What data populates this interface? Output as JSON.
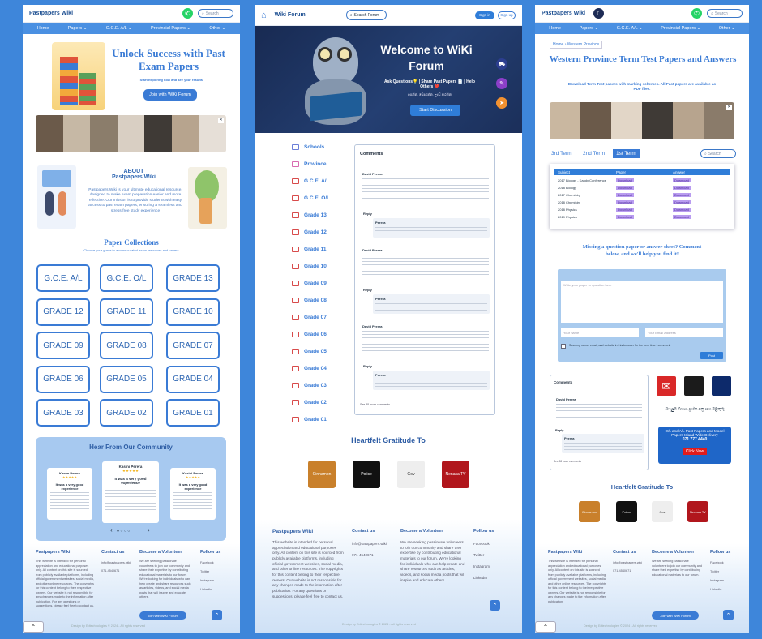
{
  "colors": {
    "accent": "#3a7bd5",
    "nav": "#4a90e2",
    "background": "#3e86da"
  },
  "panel1": {
    "brand": "Pastpapers Wiki",
    "search_placeholder": "Search",
    "nav": [
      "Home",
      "Papers ⌄",
      "G.C.E. A/L ⌄",
      "Provincial Papers ⌄",
      "Other ⌄"
    ],
    "hero_title": "Unlock Success with Past Exam Papers",
    "hero_sub": "Start exploring now and see your results!",
    "join_btn": "Join with WiKi Forum",
    "about_title": "ABOUT\nPastpapers Wiki",
    "about_text": "Pastpapers.Wiki is your ultimate educational resource, designed to make exam preparation easier and more effective. Our mission is to provide students with easy access to past exam papers, ensuring a seamless and stress-free study experience",
    "collections_title": "Paper Collections",
    "collections_sub": "Choose your grade to access curated exam resources and papers",
    "grades": [
      "G.C.E. A/L",
      "G.C.E. O/L",
      "GRADE 13",
      "GRADE 12",
      "GRADE 11",
      "GRADE 10",
      "GRADE 09",
      "GRADE 08",
      "GRADE 07",
      "GRADE 06",
      "GRADE 05",
      "GRADE 04",
      "GRADE 03",
      "GRADE 02",
      "GRADE 01"
    ],
    "community_title": "Hear From Our Community",
    "testimonials": [
      {
        "name": "Kasun Perera",
        "stars": "★★★★★",
        "quote": "It was a very good experience"
      },
      {
        "name": "Kasini Perera",
        "stars": "★★★★★",
        "quote": "It was a very good experience"
      },
      {
        "name": "Kasini Perera",
        "stars": "★★★★★",
        "quote": "It was a very good experience"
      }
    ],
    "carousel_prev": "‹",
    "carousel_next": "›",
    "footer": {
      "brand": "Pastpapers Wiki",
      "about": "This website is intended for personal appreciation and educational purposes only. All content on this site is sourced from publicly available platforms, including official government websites, social media, and other online resources. The copyrights for this content belong to their respective owners. Our website is not responsible for any changes made to the information after publication. For any questions or suggestions, please feel free to contact us.",
      "contact_title": "Contact us",
      "email": "info@pastpapers.wiki",
      "phone": "071-4540671",
      "volunteer_title": "Become a Volunteer",
      "volunteer_text": "We are seeking passionate volunteers to join our community and share their expertise by contributing educational materials to our forum. We're looking for individuals who can help create and share resources such as articles, videos, and social media posts that will inspire and educate others.",
      "join_btn": "Join with WiKi Forum",
      "follow_title": "Follow us",
      "social": [
        "Facebook",
        "Twitter",
        "Instagram",
        "LinkedIn"
      ],
      "copyright": "Design by Edtechnologies © 2024 - All rights reserved"
    }
  },
  "panel2": {
    "brand": "Wiki Forum",
    "search_label": "Search Forum",
    "signin": "Sign in",
    "signup": "Sign up",
    "hero_title": "Welcome to WiKi Forum",
    "hero_sub": "Ask Questions💡 | Share Past Papers 📄 | Help Others ❤️",
    "hero_sub2": "අසන්න, බෙදාගන්න, උදව් කරන්න",
    "hero_btn": "Start Discussion",
    "categories": [
      "Schools",
      "Province",
      "G.C.E. A/L",
      "G.C.E. O/L",
      "Grade 13",
      "Grade 12",
      "Grade 11",
      "Grade 10",
      "Grade 09",
      "Grade 08",
      "Grade 07",
      "Grade 06",
      "Grade 05",
      "Grade 04",
      "Grade 03",
      "Grade 02",
      "Grade 01"
    ],
    "comments_title": "Comments",
    "comment_author": "David Perera",
    "reply_label": "Reply",
    "reply_author": "Perera",
    "see_all": "See 38 more comments",
    "gratitude_title": "Heartfelt Gratitude To",
    "partners": [
      "Cinnamon",
      "Police",
      "Gov",
      "Nenasa TV"
    ],
    "footer": {
      "brand": "Pastpapers Wiki",
      "about": "This website is intended for personal appreciation and educational purposes only. All content on this site is sourced from publicly available platforms, including official government websites, social media, and other online resources. The copyrights for this content belong to their respective owners. Our website is not responsible for any changes made to the information after publication. For any questions or suggestions, please feel free to contact us.",
      "contact_title": "Contact us",
      "email": "info@pastpapers.wiki",
      "phone": "071-4540671",
      "volunteer_title": "Become a Volunteer",
      "volunteer_text": "We are seeking passionate volunteers to join our community and share their expertise by contributing educational materials to our forum. We're looking for individuals who can help create and share resources such as articles, videos, and social media posts that will inspire and educate others.",
      "follow_title": "Follow us",
      "social": [
        "Facebook",
        "Twitter",
        "Instagram",
        "LinkedIn"
      ],
      "copyright": "Design by Edtechnologies © 2024 - All rights reserved"
    }
  },
  "panel3": {
    "brand": "Pastpapers Wiki",
    "search_placeholder": "Search",
    "nav": [
      "Home",
      "Papers ⌄",
      "G.C.E. A/L ⌄",
      "Provincial Papers ⌄",
      "Other ⌄"
    ],
    "breadcrumb": "Home › Western Province",
    "title": "Western Province Term Test Papers and Answers",
    "subtitle": "Download Term Test papers with marking schemes. All Past papers are available as PDF files.",
    "terms": [
      "3rd Term",
      "2nd Term",
      "1st Term"
    ],
    "search_label": "Search",
    "table_headers": [
      "Subject",
      "Paper",
      "Answer"
    ],
    "table_rows": [
      {
        "subject": "2017 Biology - Kandy Conference",
        "paper": "Download",
        "answer": "Download"
      },
      {
        "subject": "2018 Biology",
        "paper": "Download",
        "answer": "Download"
      },
      {
        "subject": "2017 Chemistry",
        "paper": "Download",
        "answer": "Download"
      },
      {
        "subject": "2018 Chemistry",
        "paper": "Download",
        "answer": "Download"
      },
      {
        "subject": "2018 Physics",
        "paper": "Download",
        "answer": "Download"
      },
      {
        "subject": "2019 Physics",
        "paper": "Download",
        "answer": "Download"
      }
    ],
    "missing_title": "Missing a question paper or answer sheet? Comment below, and we'll help you find it!",
    "comment_placeholder": "Write your paper or question here",
    "name_placeholder": "Your name",
    "email_placeholder": "Your Email Address",
    "save_label": "Save my name, email, and website in this browser for the next time I comment.",
    "post_btn": "Post",
    "comments_title": "Comments",
    "comment_author": "David Perera",
    "reply_label": "Reply",
    "reply_author": "Perera",
    "see_all": "See 38 more comments",
    "sinhala_text": "සියලුම විභාග ප්‍රශ්න පත්‍ර සහ පිළිතුරු",
    "ad_text": "O/L and A/L Past Papers and Model Papers Island Wide Delivery",
    "ad_phone": "071 777 4440",
    "click_now": "Click Now",
    "gratitude_title": "Heartfelt Gratitude To",
    "partners": [
      "Cinnamon",
      "Police",
      "Gov",
      "Nenasa TV"
    ],
    "footer": {
      "brand": "Pastpapers Wiki",
      "about": "This website is intended for personal appreciation and educational purposes only. All content on this site is sourced from publicly available platforms, including official government websites, social media, and other online resources. The copyrights for this content belong to their respective owners. Our website is not responsible for any changes made to the information after publication.",
      "contact_title": "Contact us",
      "email": "info@pastpapers.wiki",
      "phone": "071-4540671",
      "volunteer_title": "Become a Volunteer",
      "volunteer_text": "We are seeking passionate volunteers to join our community and share their expertise by contributing educational materials to our forum.",
      "join_btn": "Join with WiKi Forum",
      "follow_title": "Follow us",
      "social": [
        "Facebook",
        "Twitter",
        "Instagram",
        "LinkedIn"
      ],
      "copyright": "Design by Edtechnologies © 2024 - All rights reserved"
    }
  }
}
